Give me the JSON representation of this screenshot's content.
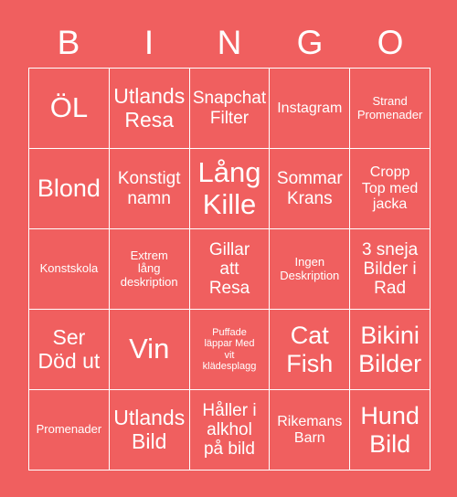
{
  "card": {
    "background_color": "#f05f5f",
    "text_color": "#ffffff",
    "grid_line_color": "#ffffff",
    "header_letters": [
      "B",
      "I",
      "N",
      "G",
      "O"
    ],
    "rows": [
      [
        {
          "text": "ÖL",
          "size": "xxl"
        },
        {
          "text": "Utlands\nResa",
          "size": "lg"
        },
        {
          "text": "Snapchat\nFilter",
          "size": "md"
        },
        {
          "text": "Instagram",
          "size": "sm"
        },
        {
          "text": "Strand\nPromenader",
          "size": "xs"
        }
      ],
      [
        {
          "text": "Blond",
          "size": "xl"
        },
        {
          "text": "Konstigt\nnamn",
          "size": "md"
        },
        {
          "text": "Lång\nKille",
          "size": "xxl"
        },
        {
          "text": "Sommar\nKrans",
          "size": "md"
        },
        {
          "text": "Cropp\nTop med\njacka",
          "size": "sm"
        }
      ],
      [
        {
          "text": "Konstskola",
          "size": "xs"
        },
        {
          "text": "Extrem\nlång\ndeskription",
          "size": "xs"
        },
        {
          "text": "Gillar\natt\nResa",
          "size": "md"
        },
        {
          "text": "Ingen\nDeskription",
          "size": "xs"
        },
        {
          "text": "3 sneja\nBilder i\nRad",
          "size": "md"
        }
      ],
      [
        {
          "text": "Ser\nDöd ut",
          "size": "lg"
        },
        {
          "text": "Vin",
          "size": "xxl"
        },
        {
          "text": "Puffade\nläppar Med\nvit\nklädesplagg",
          "size": "xxs"
        },
        {
          "text": "Cat\nFish",
          "size": "xl"
        },
        {
          "text": "Bikini\nBilder",
          "size": "xl"
        }
      ],
      [
        {
          "text": "Promenader",
          "size": "xs"
        },
        {
          "text": "Utlands\nBild",
          "size": "lg"
        },
        {
          "text": "Håller i\nalkhol\npå bild",
          "size": "md"
        },
        {
          "text": "Rikemans\nBarn",
          "size": "sm"
        },
        {
          "text": "Hund\nBild",
          "size": "xl"
        }
      ]
    ]
  }
}
